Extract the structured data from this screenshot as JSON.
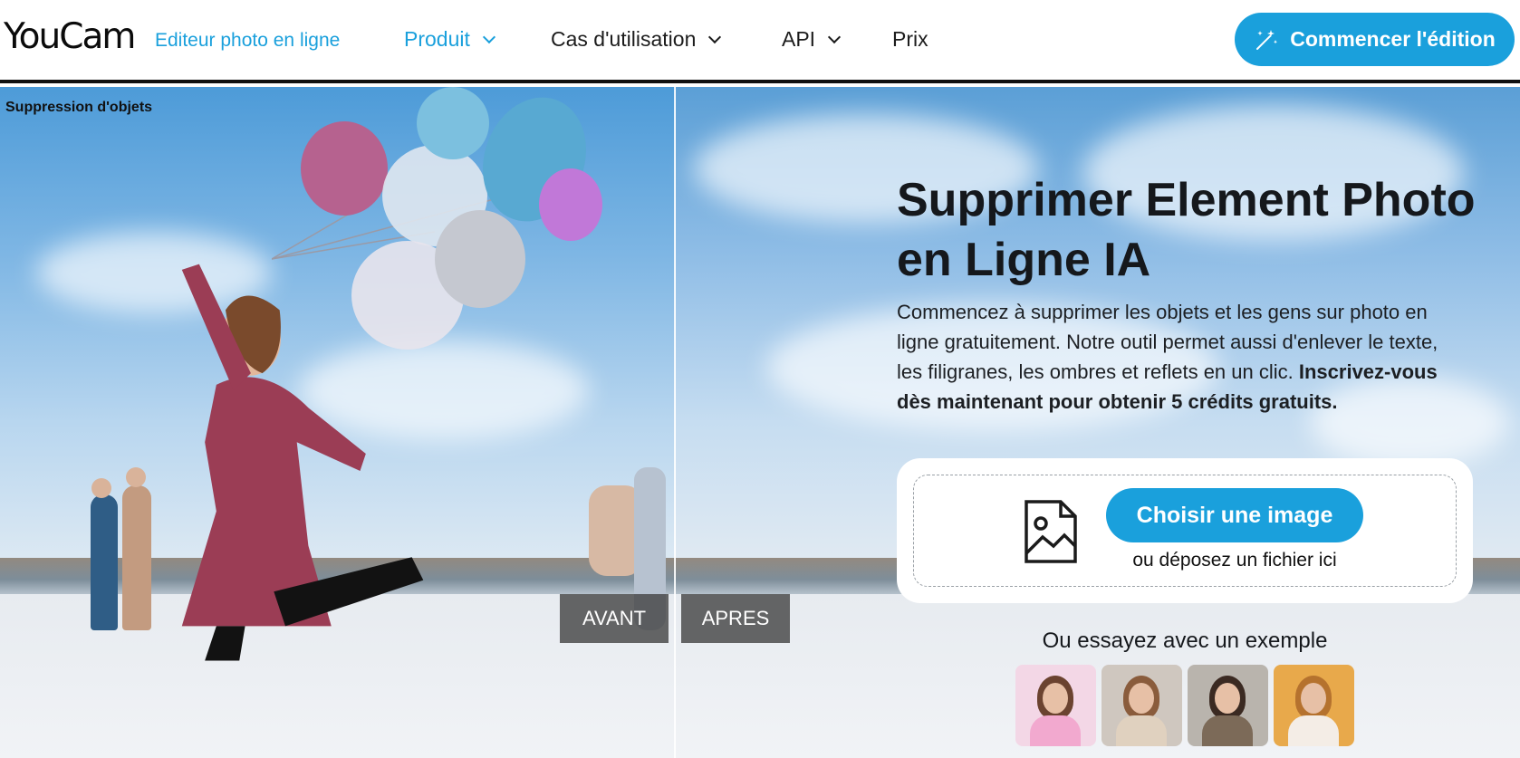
{
  "header": {
    "logo": "YouCam",
    "tagline": "Editeur photo en ligne",
    "nav": [
      {
        "label": "Produit",
        "dropdown": true,
        "active": true
      },
      {
        "label": "Cas d'utilisation",
        "dropdown": true,
        "active": false
      },
      {
        "label": "API",
        "dropdown": true,
        "active": false
      },
      {
        "label": "Prix",
        "dropdown": false,
        "active": false
      }
    ],
    "cta_label": "Commencer l'édition",
    "cta_icon": "magic-wand-icon"
  },
  "hero": {
    "section_label": "Suppression d'objets",
    "before_label": "AVANT",
    "after_label": "APRES",
    "title": "Supprimer Element Photo en Ligne IA",
    "description": "Commencez à supprimer les objets et les gens sur photo en ligne gratuitement. Notre outil permet aussi d'enlever le texte, les filigranes, les ombres et reflets en un clic.",
    "description_bold": "Inscrivez-vous dès maintenant pour obtenir 5 crédits gratuits.",
    "upload": {
      "icon": "image-file-icon",
      "button_label": "Choisir une image",
      "drop_text": "ou déposez un fichier ici"
    },
    "examples_label": "Ou essayez avec un exemple",
    "examples": [
      {
        "name": "example-pink-jacket",
        "bg": "#f3d7e6",
        "hair": "#6b4330",
        "body": "#f2a9cf"
      },
      {
        "name": "example-street-coffee",
        "bg": "#cfc7bf",
        "hair": "#8a5c3c",
        "body": "#e0d1bf"
      },
      {
        "name": "example-street-coat",
        "bg": "#b9b4ad",
        "hair": "#3b2a22",
        "body": "#7c6a58"
      },
      {
        "name": "example-autumn-hat",
        "bg": "#e8a94b",
        "hair": "#b5722e",
        "body": "#f4ede6"
      }
    ]
  },
  "colors": {
    "brand": "#1aa0dc",
    "text": "#15181c"
  }
}
